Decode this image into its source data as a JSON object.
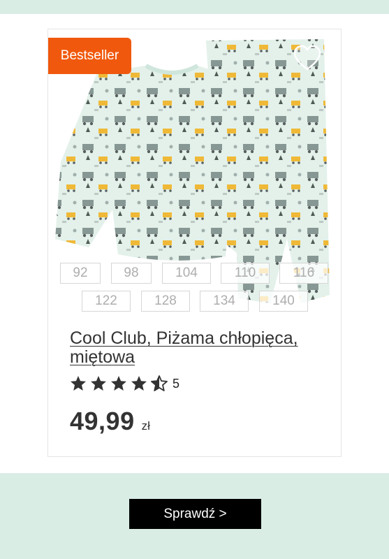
{
  "product": {
    "badge": "Bestseller",
    "sizes": [
      "92",
      "98",
      "104",
      "110",
      "116",
      "122",
      "128",
      "134",
      "140"
    ],
    "title": "Cool Club, Piżama chłopięca, miętowa",
    "rating": 4.5,
    "review_count": "5",
    "price": "49,99",
    "currency": "zł"
  },
  "cta": {
    "label": "Sprawdź >"
  },
  "colors": {
    "band": "#d9ede5",
    "badge": "#f0590d",
    "pajama": "#e3f1ea",
    "star": "#333333",
    "button": "#000000"
  }
}
